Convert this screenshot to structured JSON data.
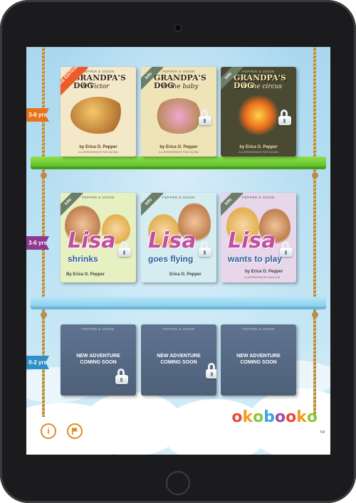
{
  "shelves": [
    {
      "age_label": "3-6 yrs",
      "age_color": "#e8731f",
      "books": [
        {
          "publisher": "PEPPER & ONION",
          "title": "GRANDPA'S DOG",
          "subtitle": "& Victor",
          "author": "by Erica O. Pepper",
          "illustrator": "ILLUSTRATIONS BY FOG SULTAN",
          "ribbon": "FREE EDITION",
          "locked": false,
          "cover": "#f3e8c7",
          "accent": "#f2b66a"
        },
        {
          "publisher": "PEPPER & ONION",
          "title": "GRANDPA'S DOG",
          "subtitle": "& the baby",
          "author": "by Erica O. Pepper",
          "illustrator": "ILLUSTRATIONS BY FOG SULTAN",
          "ribbon": "Info",
          "locked": true,
          "cover": "#efe4b8",
          "accent": "#e9a4c8"
        },
        {
          "publisher": "PEPPER & ONION",
          "title": "GRANDPA'S DOG",
          "subtitle": "& the circus",
          "author": "by Erica O. Pepper",
          "illustrator": "ILLUSTRATIONS BY FOG SULTAN",
          "ribbon": "Info",
          "locked": true,
          "cover": "#4a4a33",
          "accent": "#f39a1f"
        }
      ]
    },
    {
      "age_label": "3-6 yrs",
      "age_color": "#8d3a8f",
      "books": [
        {
          "publisher": "PEPPER & ONION",
          "title": "Lisa",
          "subtitle": "shrinks",
          "author": "By Erica O. Pepper",
          "ribbon": "Info",
          "locked": true,
          "cover": "#e6f0c0"
        },
        {
          "publisher": "PEPPER & ONION",
          "title": "Lisa",
          "subtitle": "goes flying",
          "author": "Erica O. Pepper",
          "ribbon": "Info",
          "locked": true,
          "cover": "#d5ecf1"
        },
        {
          "publisher": "PEPPER & ONION",
          "title": "Lisa",
          "subtitle": "wants to play",
          "author": "by Erica O. Pepper",
          "illustrator": "ILLUSTRATIONS BY EVA LILJA",
          "ribbon": "Info",
          "locked": true,
          "cover": "#e8d6ea"
        }
      ]
    },
    {
      "age_label": "0-2 yrs",
      "age_color": "#2f8fc6",
      "books": [
        {
          "publisher": "PEPPER & ONION",
          "line1": "NEW ADVENTURE",
          "line2": "COMING SOON",
          "locked": true
        },
        {
          "publisher": "PEPPER & ONION",
          "line1": "NEW ADVENTURE",
          "line2": "COMING SOON",
          "locked": true
        },
        {
          "publisher": "PEPPER & ONION",
          "line1": "NEW ADVENTURE",
          "line2": "COMING SOON",
          "locked": true
        }
      ]
    }
  ],
  "footer": {
    "info_button": "i",
    "flag_icon": "flag-icon",
    "logo_letters": [
      "o",
      "k",
      "o",
      "b",
      "o",
      "o",
      "k",
      "o"
    ],
    "logo_colors": [
      "#e94a3b",
      "#f39a1f",
      "#8dc63f",
      "#3aa8dd",
      "#a249a4",
      "#e94a3b",
      "#f39a1f",
      "#8dc63f"
    ],
    "logo_tm": "TM"
  }
}
